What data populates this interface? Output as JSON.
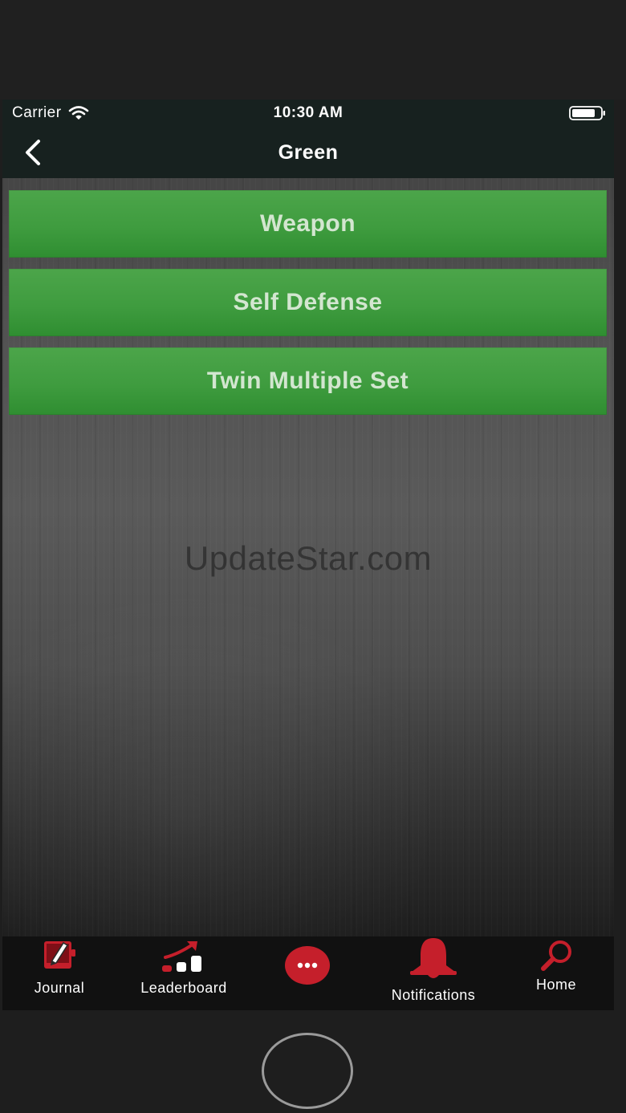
{
  "status_bar": {
    "carrier": "Carrier",
    "time": "10:30 AM",
    "wifi_icon": "wifi-icon",
    "battery_icon": "battery-icon"
  },
  "nav": {
    "title": "Green",
    "back_icon": "chevron-left-icon"
  },
  "menu_items": [
    {
      "label": "Weapon"
    },
    {
      "label": "Self Defense"
    },
    {
      "label": "Twin Multiple Set"
    }
  ],
  "watermark": "UpdateStar.com",
  "tabs": [
    {
      "label": "Journal",
      "icon": "journal-icon"
    },
    {
      "label": "Leaderboard",
      "icon": "leaderboard-icon"
    },
    {
      "label": "",
      "icon": "more-icon"
    },
    {
      "label": "Notifications",
      "icon": "bell-icon"
    },
    {
      "label": "Home",
      "icon": "search-icon"
    }
  ],
  "colors": {
    "accent_red": "#c51f2b",
    "button_green": "#3f9c3f",
    "bar_background": "#17211f",
    "tab_background": "#111111"
  }
}
